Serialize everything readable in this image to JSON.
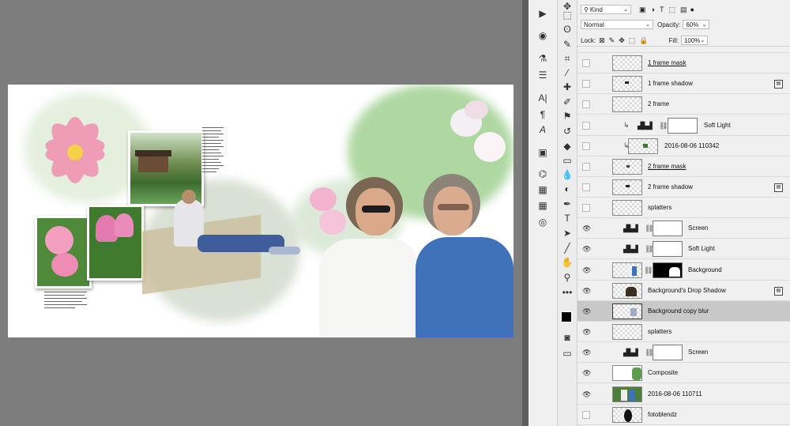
{
  "toolbar_icons": [
    "move-icon",
    "marquee-icon",
    "lasso-icon",
    "quick-select-icon",
    "crop-icon",
    "eyedropper-icon",
    "healing-icon",
    "brush-icon",
    "stamp-icon",
    "history-brush-icon",
    "eraser-icon",
    "gradient-icon",
    "blur-icon",
    "dodge-icon",
    "pen-icon",
    "type-icon",
    "path-select-icon",
    "line-icon",
    "hand-icon",
    "zoom-icon",
    "more-icon"
  ],
  "side_panel_icons": [
    "play-icon",
    "channels-icon",
    "adjustments-icon",
    "properties-icon",
    "character-icon",
    "paragraph-icon",
    "glyphs-icon",
    "swatches-icon",
    "libraries-icon",
    "3d-icon",
    "grid-icon",
    "creative-cloud-icon"
  ],
  "layers_panel": {
    "filter_kind": "Kind",
    "blend_mode": "Normal",
    "opacity_label": "Opacity:",
    "opacity_value": "60%",
    "lock_label": "Lock:",
    "fill_label": "Fill:",
    "fill_value": "100%",
    "layers": [
      {
        "name": "1 frame mask",
        "visible": false
      },
      {
        "name": "1 frame shadow",
        "visible": false
      },
      {
        "name": "2 frame",
        "visible": false
      },
      {
        "name": "Soft Light",
        "visible": false
      },
      {
        "name": "2016-08-06 110342",
        "visible": false
      },
      {
        "name": "2 frame mask",
        "visible": false
      },
      {
        "name": "2 frame shadow",
        "visible": false
      },
      {
        "name": "splatters",
        "visible": false
      },
      {
        "name": "Screen",
        "visible": true
      },
      {
        "name": "Soft Light",
        "visible": true
      },
      {
        "name": "Background",
        "visible": true
      },
      {
        "name": "Background's Drop Shadow",
        "visible": true
      },
      {
        "name": "Background copy blur",
        "visible": true,
        "selected": true
      },
      {
        "name": "splatters",
        "visible": true
      },
      {
        "name": "Screen",
        "visible": true
      },
      {
        "name": "Composite",
        "visible": true
      },
      {
        "name": "2016-08-06 110711",
        "visible": true
      },
      {
        "name": "fotoblendz",
        "visible": false
      }
    ]
  },
  "colors": {
    "panel_bg": "#f0f0f0",
    "selected_row": "#c8c8c8",
    "canvas_bg": "#7d7d7d"
  }
}
